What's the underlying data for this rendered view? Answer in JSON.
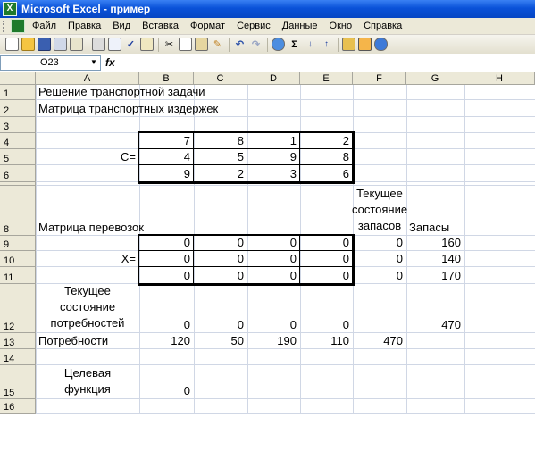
{
  "window": {
    "title": "Microsoft Excel - пример",
    "app_icon": "excel-icon"
  },
  "menu": [
    "Файл",
    "Правка",
    "Вид",
    "Вставка",
    "Формат",
    "Сервис",
    "Данные",
    "Окно",
    "Справка"
  ],
  "toolbar": {
    "icons": [
      "new-icon",
      "open-icon",
      "save-icon",
      "permission-icon",
      "email-icon",
      "print-icon",
      "print-preview-icon",
      "spelling-icon",
      "research-icon",
      "cut-icon",
      "copy-icon",
      "paste-icon",
      "format-painter-icon",
      "undo-icon",
      "redo-icon",
      "hyperlink-icon",
      "autosum-icon",
      "sort-asc-icon",
      "sort-desc-icon",
      "chart-wizard-icon",
      "drawing-icon",
      "help-icon"
    ],
    "sigma": "Σ"
  },
  "formula_bar": {
    "name_box": "O23",
    "fx": "fx",
    "content": ""
  },
  "columns": [
    "A",
    "B",
    "C",
    "D",
    "E",
    "F",
    "G",
    "H"
  ],
  "rows": [
    "1",
    "2",
    "3",
    "4",
    "5",
    "6",
    "7",
    "8",
    "9",
    "10",
    "11",
    "12",
    "13",
    "14",
    "15",
    "16"
  ],
  "cells": {
    "A1": "Решение транспортной задачи",
    "A2": "Матрица транспортных издержек",
    "A5": "C=",
    "B4": "7",
    "C4": "8",
    "D4": "1",
    "E4": "2",
    "B5": "4",
    "C5": "5",
    "D5": "9",
    "E5": "8",
    "B6": "9",
    "C6": "2",
    "D6": "3",
    "E6": "6",
    "A8": "Матрица перевозок",
    "F8": [
      "Текущее",
      "состояние",
      "запасов"
    ],
    "G8": "Запасы",
    "A10": "X=",
    "B9": "0",
    "C9": "0",
    "D9": "0",
    "E9": "0",
    "F9": "0",
    "G9": "160",
    "B10": "0",
    "C10": "0",
    "D10": "0",
    "E10": "0",
    "F10": "0",
    "G10": "140",
    "B11": "0",
    "C11": "0",
    "D11": "0",
    "E11": "0",
    "F11": "0",
    "G11": "170",
    "A12": [
      "Текущее",
      "состояние",
      "потребностей"
    ],
    "B12": "0",
    "C12": "0",
    "D12": "0",
    "E12": "0",
    "G12": "470",
    "A13": "Потребности",
    "B13": "120",
    "C13": "50",
    "D13": "190",
    "E13": "110",
    "F13": "470",
    "A15": [
      "Целевая",
      "функция"
    ],
    "B15": "0"
  },
  "colors": {
    "title_blue": "#0a52d8",
    "chrome": "#ece9d8",
    "gridline": "#d0d7e5",
    "header_border": "#a7a69d"
  }
}
